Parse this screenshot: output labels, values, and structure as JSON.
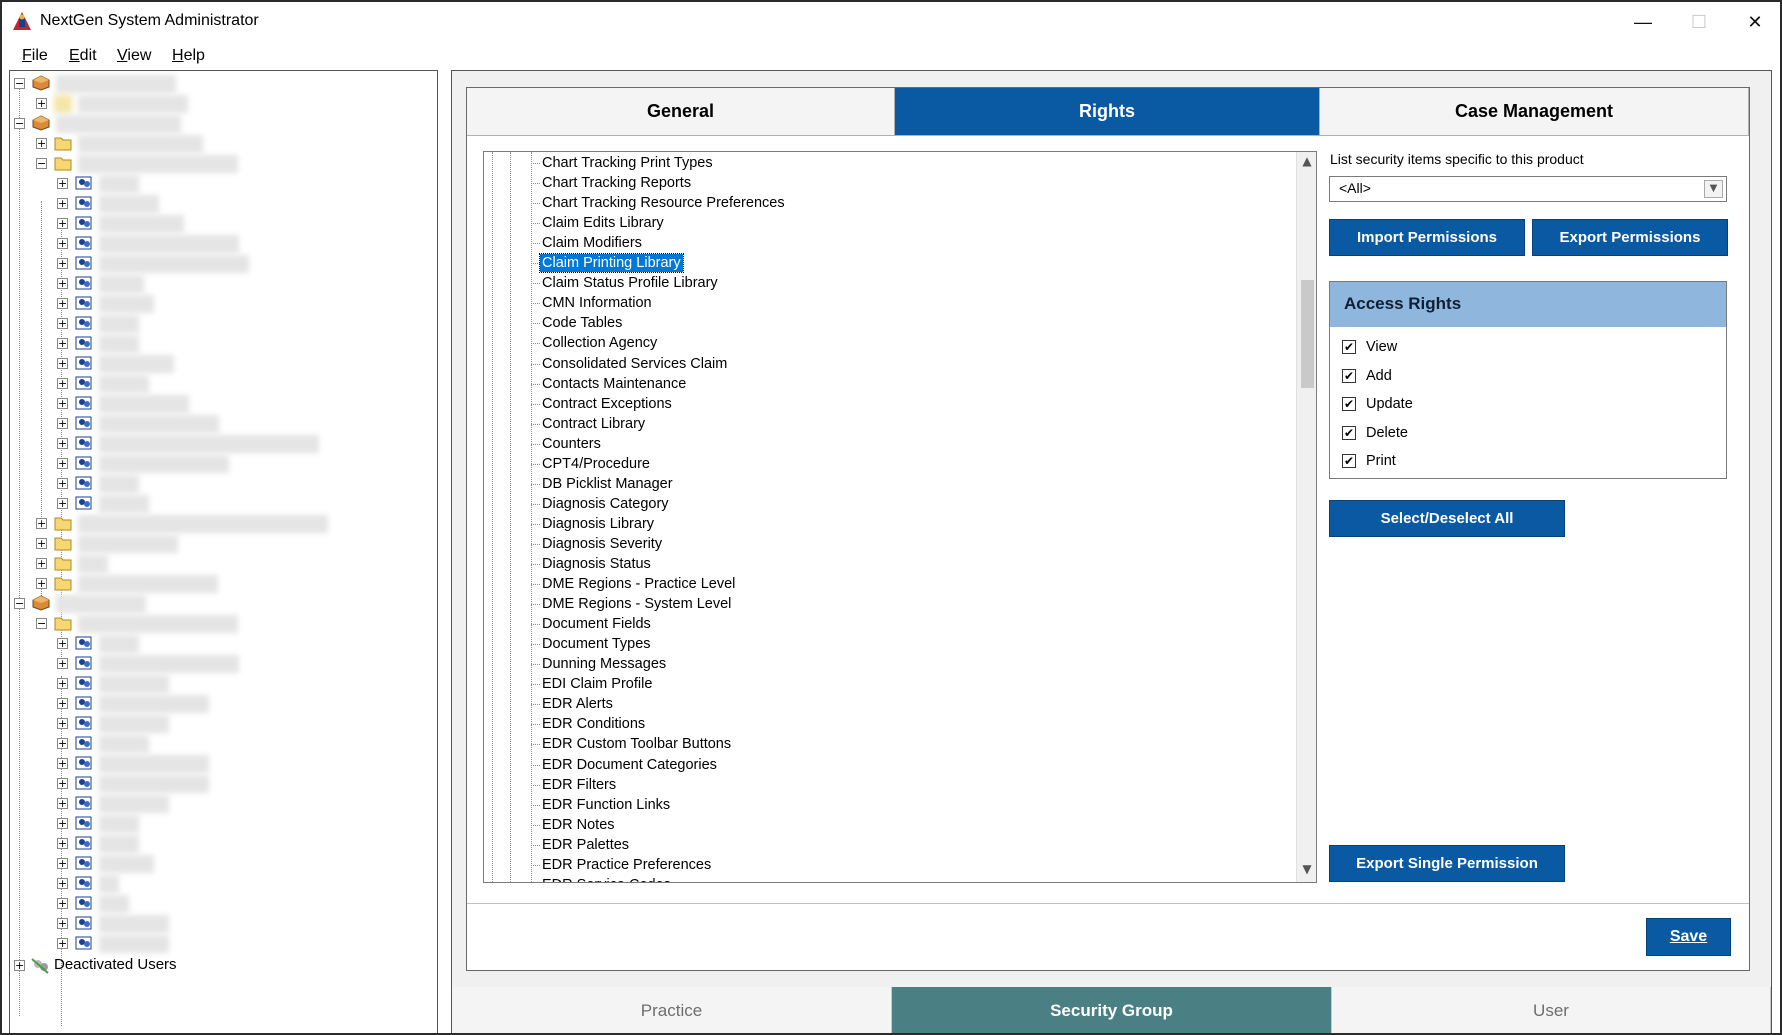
{
  "window": {
    "title": "NextGen System Administrator"
  },
  "menu": {
    "file": "File",
    "edit": "Edit",
    "view": "View",
    "help": "Help"
  },
  "tree": {
    "deactivated_label": "Deactivated Users"
  },
  "tabs": {
    "general": "General",
    "rights": "Rights",
    "case_management": "Case Management"
  },
  "list": {
    "selected_index": 5,
    "items": [
      "Chart Tracking Print Types",
      "Chart Tracking Reports",
      "Chart Tracking Resource Preferences",
      "Claim Edits Library",
      "Claim Modifiers",
      "Claim Printing Library",
      "Claim Status Profile Library",
      "CMN Information",
      "Code Tables",
      "Collection Agency",
      "Consolidated Services Claim",
      "Contacts Maintenance",
      "Contract Exceptions",
      "Contract Library",
      "Counters",
      "CPT4/Procedure",
      "DB Picklist Manager",
      "Diagnosis Category",
      "Diagnosis Library",
      "Diagnosis Severity",
      "Diagnosis Status",
      "DME Regions - Practice Level",
      "DME Regions - System Level",
      "Document Fields",
      "Document Types",
      "Dunning Messages",
      "EDI Claim Profile",
      "EDR Alerts",
      "EDR Conditions",
      "EDR Custom Toolbar Buttons",
      "EDR Document Categories",
      "EDR Filters",
      "EDR Function Links",
      "EDR Notes",
      "EDR Palettes",
      "EDR Practice Preferences",
      "EDR Service Codes"
    ]
  },
  "filter": {
    "label": "List security items specific to this product",
    "value": "<All>"
  },
  "buttons": {
    "import": "Import Permissions",
    "export": "Export Permissions",
    "select_all": "Select/Deselect All",
    "export_single": "Export Single Permission",
    "save": "Save"
  },
  "access": {
    "title": "Access Rights",
    "check_glyph": "✔",
    "items": [
      {
        "label": "View",
        "checked": true
      },
      {
        "label": "Add",
        "checked": true
      },
      {
        "label": "Update",
        "checked": true
      },
      {
        "label": "Delete",
        "checked": true
      },
      {
        "label": "Print",
        "checked": true
      }
    ]
  },
  "bottom_tabs": {
    "practice": "Practice",
    "security_group": "Security Group",
    "user": "User"
  },
  "colors": {
    "accent": "#0a5aa3",
    "bottom_active": "#4a7f84",
    "access_header": "#8fb7de"
  }
}
